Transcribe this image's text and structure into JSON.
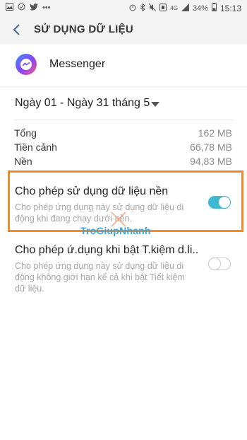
{
  "status_bar": {
    "left_icons": [
      "gallery-icon",
      "sync-icon",
      "twitter-icon",
      "more-icon"
    ],
    "right_icons": [
      "alarm-icon",
      "bluetooth-icon",
      "mute-icon",
      "nfc-icon",
      "lte-icon",
      "signal-icon"
    ],
    "network": "4G",
    "battery": "34%",
    "time": "15:13"
  },
  "header": {
    "back_icon": "back-chevron-icon",
    "title": "SỬ DỤNG DỮ LIỆU"
  },
  "app": {
    "name": "Messenger",
    "icon": "messenger-icon"
  },
  "date_range": {
    "label": "Ngày 01 - Ngày 31 tháng 5"
  },
  "usage": [
    {
      "label": "Tổng",
      "value": "162 MB"
    },
    {
      "label": "Tiền cảnh",
      "value": "66,78 MB"
    },
    {
      "label": "Nền",
      "value": "94,83 MB"
    }
  ],
  "settings": [
    {
      "title": "Cho phép sử dụng dữ liệu nền",
      "description": "Cho phép ứng dụng này sử dụng dữ liệu di động khi đang chạy dưới nền.",
      "enabled": true
    },
    {
      "title": "Cho phép ứ.dụng khi bật T.kiệm d.li..",
      "description": "Cho phép ứng dụng này sử dụng dữ liệu di động không giới hạn kể cả khi bật Tiết kiệm dữ liệu.",
      "enabled": false
    }
  ],
  "colors": {
    "accent": "#3fb8d4",
    "highlight_border": "#ef8a2e",
    "watermark": "#3ea3d8"
  },
  "watermark": {
    "text": "TroGiupNhanh"
  }
}
